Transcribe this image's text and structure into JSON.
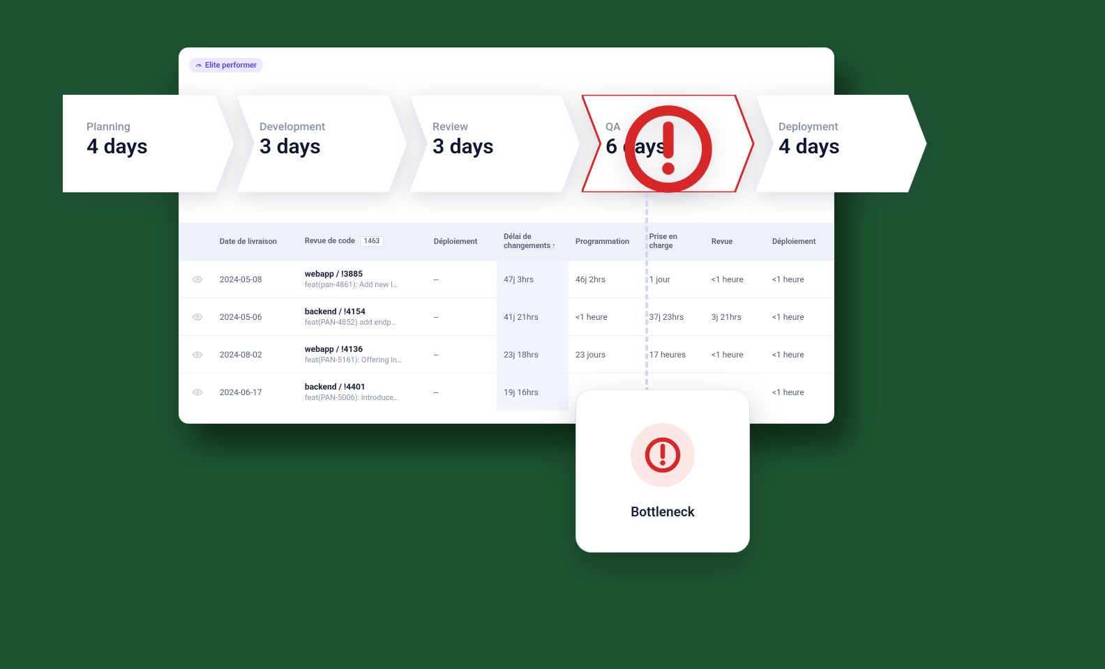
{
  "badge": {
    "label": "Elite performer"
  },
  "pipeline": [
    {
      "label": "Planning",
      "value": "4 days",
      "highlight": false
    },
    {
      "label": "Development",
      "value": "3 days",
      "highlight": false
    },
    {
      "label": "Review",
      "value": "3 days",
      "highlight": false
    },
    {
      "label": "QA",
      "value": "6 days",
      "highlight": true
    },
    {
      "label": "Deployment",
      "value": "4 days",
      "highlight": false
    }
  ],
  "table": {
    "headers": {
      "date": "Date de livraison",
      "revue_code": "Revue de code",
      "revue_count": "1463",
      "deploiement": "Déploiement",
      "delai": "Délai de changements",
      "programmation": "Programmation",
      "prise": "Prise en charge",
      "revue": "Revue",
      "deploiement2": "Déploiement"
    },
    "rows": [
      {
        "date": "2024-05-08",
        "title": "webapp / !3885",
        "sub": "feat(pan-4861): Add new l…",
        "deploy": "--",
        "delai": "47j 3hrs",
        "prog": "46j 2hrs",
        "prise": "1 jour",
        "revue": "<1 heure",
        "dep2": "<1 heure"
      },
      {
        "date": "2024-05-06",
        "title": "backend / !4154",
        "sub": "feat(PAN-4852) add endp…",
        "deploy": "--",
        "delai": "41j 21hrs",
        "prog": "<1 heure",
        "prise": "37j 23hrs",
        "revue": "3j 21hrs",
        "dep2": "<1 heure"
      },
      {
        "date": "2024-08-02",
        "title": "webapp / !4136",
        "sub": "feat(PAN-5161): Offering in…",
        "deploy": "--",
        "delai": "23j 18hrs",
        "prog": "23 jours",
        "prise": "17 heures",
        "revue": "<1 heure",
        "dep2": "<1 heure"
      },
      {
        "date": "2024-06-17",
        "title": "backend / !4401",
        "sub": "feat(PAN-5006): introduce…",
        "deploy": "--",
        "delai": "19j 16hrs",
        "prog": "",
        "prise": "",
        "revue": "",
        "dep2": "<1 heure"
      }
    ]
  },
  "popup": {
    "label": "Bottleneck"
  }
}
